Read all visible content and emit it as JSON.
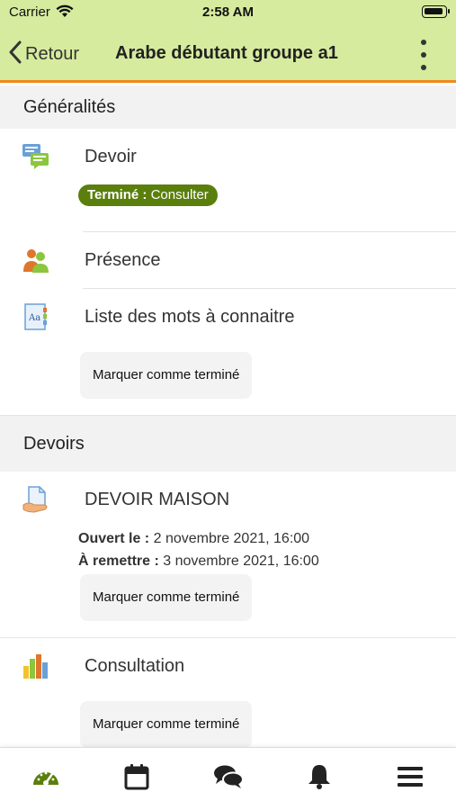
{
  "status_bar": {
    "carrier": "Carrier",
    "time": "2:58 AM"
  },
  "nav": {
    "back_label": "Retour",
    "title": "Arabe débutant groupe a1"
  },
  "sections": [
    {
      "title": "Généralités",
      "modules": [
        {
          "title": "Devoir",
          "icon": "assignment-icon",
          "completion_label": "Terminé :",
          "completion_action": "Consulter"
        },
        {
          "title": "Présence",
          "icon": "attendance-icon"
        },
        {
          "title": "Liste des mots à connaitre",
          "icon": "glossary-icon",
          "button": "Marquer comme terminé"
        }
      ]
    },
    {
      "title": "Devoirs",
      "modules": [
        {
          "title": "DEVOIR MAISON",
          "icon": "assignment-submit-icon",
          "opened_label": "Ouvert le :",
          "opened_date": "2 novembre 2021, 16:00",
          "due_label": "À remettre :",
          "due_date": "3 novembre 2021, 16:00",
          "button": "Marquer comme terminé"
        },
        {
          "title": "Consultation",
          "icon": "feedback-chart-icon",
          "button": "Marquer comme terminé"
        }
      ]
    }
  ],
  "tabs": [
    {
      "name": "dashboard-icon",
      "active": true
    },
    {
      "name": "calendar-icon",
      "active": false
    },
    {
      "name": "messages-icon",
      "active": false
    },
    {
      "name": "notifications-icon",
      "active": false
    },
    {
      "name": "menu-icon",
      "active": false
    }
  ],
  "colors": {
    "header_bg": "#d6eb9e",
    "accent_border": "#f0881a",
    "badge_bg": "#5a7f0c",
    "active_tab": "#5a7f0c"
  }
}
